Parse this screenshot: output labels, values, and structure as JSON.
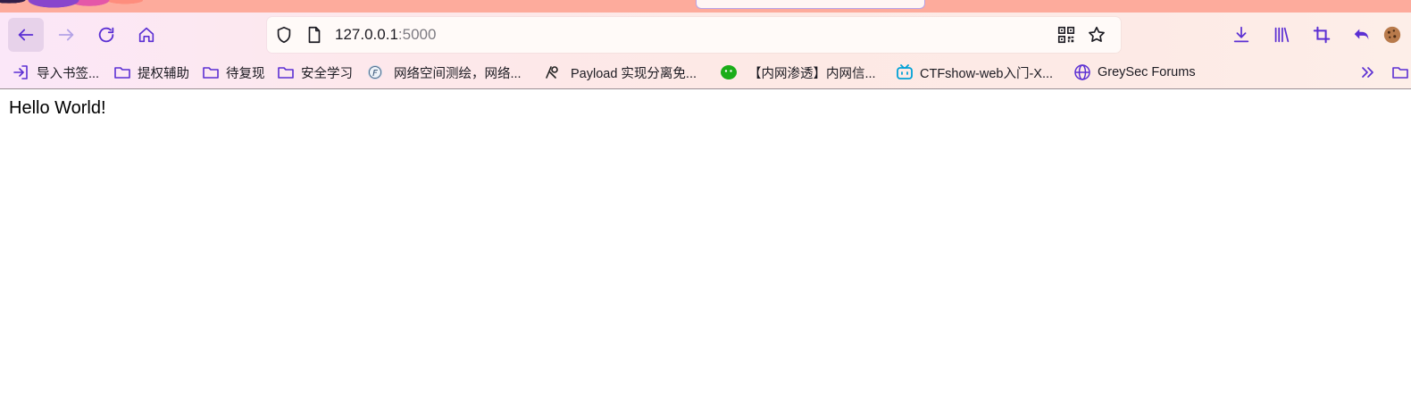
{
  "colors": {
    "accent": "#5b2fd3",
    "text": "#1c1b22",
    "port_text": "#7d7b82"
  },
  "toolbar": {
    "back_icon": "arrow-left-icon",
    "forward_icon": "arrow-right-icon",
    "reload_icon": "reload-icon",
    "home_icon": "home-icon",
    "downloads_icon": "download-icon",
    "library_icon": "library-icon",
    "screenshot_icon": "crop-icon",
    "undo_icon": "undo-icon",
    "extension_icon": "cookie-icon"
  },
  "urlbar": {
    "host": "127.0.0.1",
    "port": ":5000",
    "shield_icon": "shield-icon",
    "page_icon": "page-icon",
    "qr_icon": "qr-code-icon",
    "star_icon": "star-icon"
  },
  "bookmarks": [
    {
      "label": "导入书签...",
      "icon": "import-icon"
    },
    {
      "label": "提权辅助",
      "icon": "folder-icon"
    },
    {
      "label": "待复现",
      "icon": "folder-icon"
    },
    {
      "label": "安全学习",
      "icon": "folder-icon"
    },
    {
      "label": "网络空间测绘，网络...",
      "icon": "fofa-icon"
    },
    {
      "label": "Payload 实现分离免...",
      "icon": "site-icon"
    },
    {
      "label": "【内网渗透】内网信...",
      "icon": "wechat-icon"
    },
    {
      "label": "CTFshow-web入门-X...",
      "icon": "bilibili-icon"
    },
    {
      "label": "GreySec Forums",
      "icon": "globe-icon"
    }
  ],
  "page": {
    "body_text": "Hello World!"
  }
}
